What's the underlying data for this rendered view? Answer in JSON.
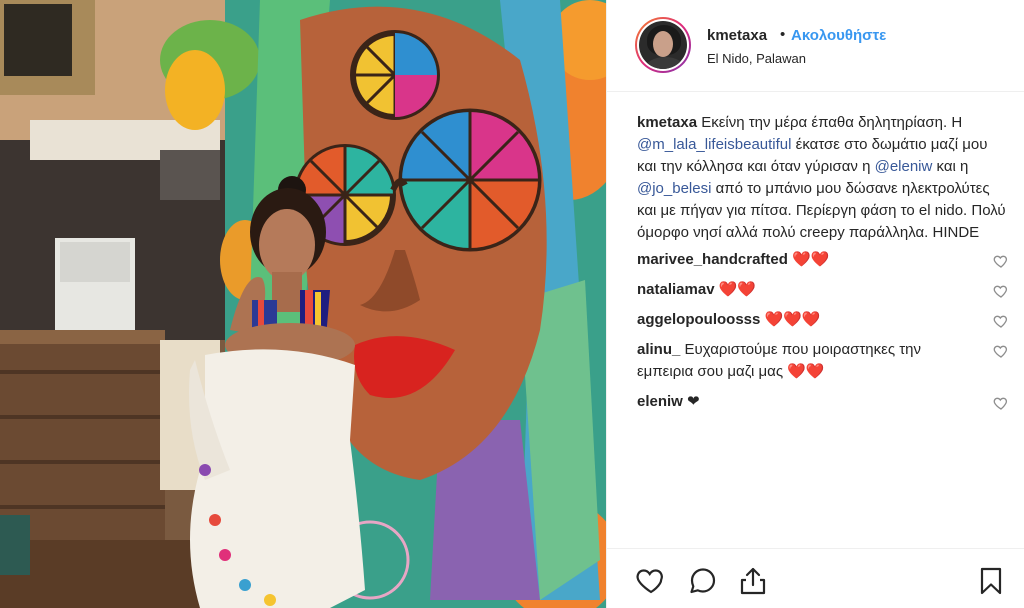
{
  "post": {
    "author": {
      "username": "kmetaxa",
      "separator": "•",
      "follow_label": "Ακολουθήστε",
      "location": "El Nido, Palawan"
    },
    "caption": {
      "username": "kmetaxa",
      "part1": " Εκείνη την μέρα έπαθα δηλητηρίαση. Η ",
      "mention1": "@m_lala_lifeisbeautiful",
      "part2": " έκατσε στο δωμάτιο μαζί μου και την κόλλησα και όταν γύρισαν η ",
      "mention2": "@eleniw",
      "part3": " και η ",
      "mention3": "@jo_belesi",
      "part4": " από το μπάνιο μου δώσανε ηλεκτρολύτες και με πήγαν για πίτσα. Περίεργη φάση το el nido. Πολύ όμορφο νησί αλλά πολύ creepy παράλληλα. HINDE"
    },
    "comments": [
      {
        "username": "marivee_handcrafted",
        "text": " ❤️❤️"
      },
      {
        "username": "nataliamav",
        "text": " ❤️❤️"
      },
      {
        "username": "aggelopouloosss",
        "text": " ❤️❤️❤️"
      },
      {
        "username": "alinu_",
        "text": " Ευχαριστούμε που μοιραστηκες την εμπειρια σου μαζι μας ❤️❤️"
      },
      {
        "username": "eleniw",
        "text": " ❤"
      }
    ],
    "icons": {
      "avatar": "profile-avatar",
      "comment_like": "heart-outline-icon",
      "like": "heart-icon",
      "comment": "speech-bubble-icon",
      "share": "share-icon",
      "save": "bookmark-icon"
    },
    "colors": {
      "follow_blue": "#3897f0",
      "text": "#262626",
      "border": "#efefef"
    }
  }
}
